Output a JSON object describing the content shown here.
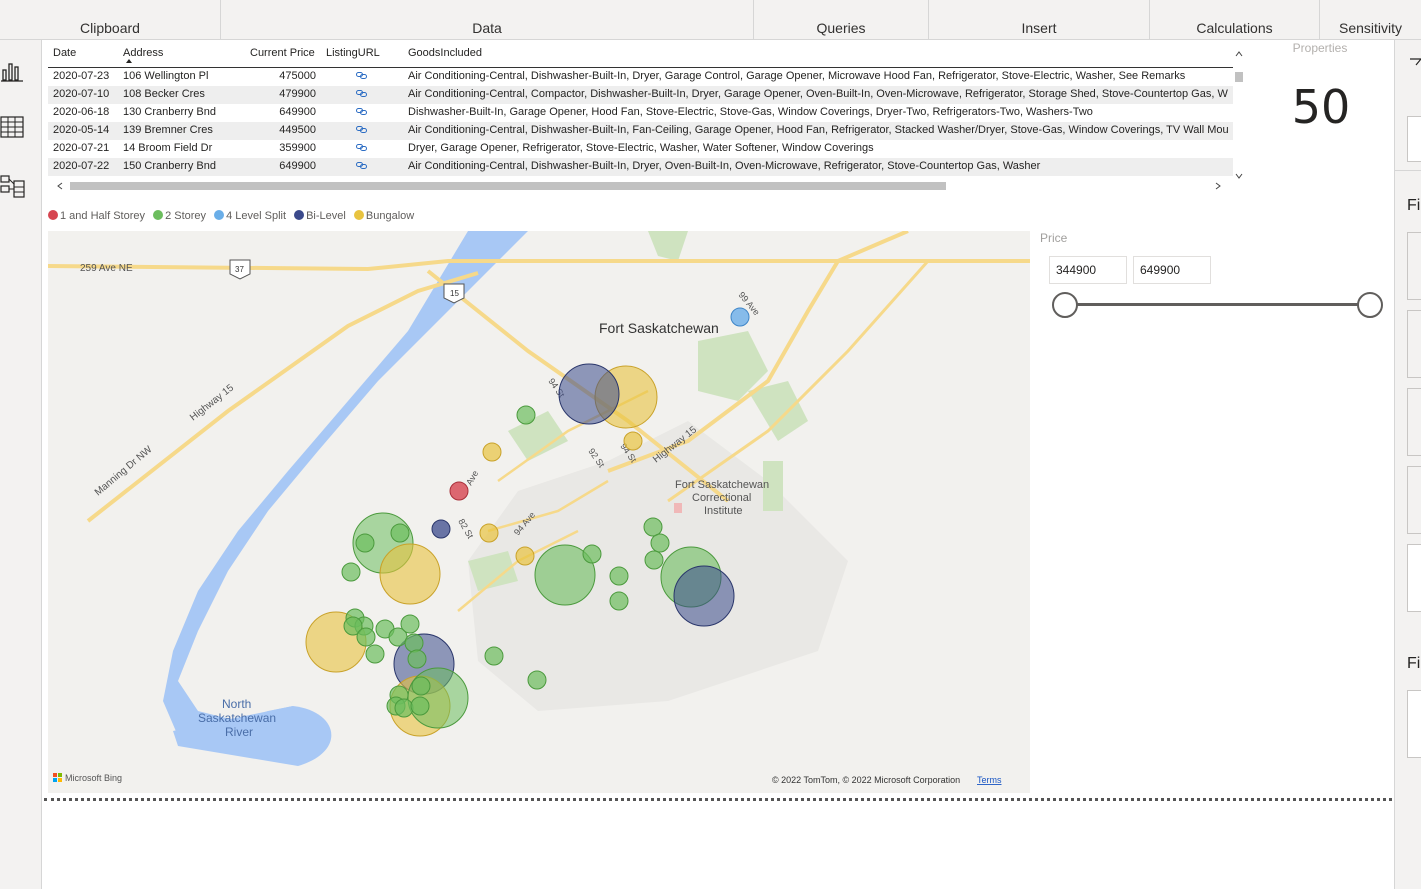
{
  "ribbon": {
    "groups": [
      "Clipboard",
      "Data",
      "Queries",
      "Insert",
      "Calculations",
      "Sensitivity"
    ]
  },
  "table": {
    "headers": [
      "Date",
      "Address",
      "Current Price",
      "ListingURL",
      "GoodsIncluded"
    ],
    "rows": [
      {
        "date": "2020-07-23",
        "address": "106 Wellington Pl",
        "price": "475000",
        "goods": "Air Conditioning-Central, Dishwasher-Built-In, Dryer, Garage Control, Garage Opener, Microwave Hood Fan, Refrigerator, Stove-Electric, Washer, See Remarks"
      },
      {
        "date": "2020-07-10",
        "address": "108 Becker Cres",
        "price": "479900",
        "goods": "Air Conditioning-Central, Compactor, Dishwasher-Built-In, Dryer, Garage Opener, Oven-Built-In, Oven-Microwave, Refrigerator, Storage Shed, Stove-Countertop Gas, W"
      },
      {
        "date": "2020-06-18",
        "address": "130 Cranberry Bnd",
        "price": "649900",
        "goods": "Dishwasher-Built-In, Garage Opener, Hood Fan, Stove-Electric, Stove-Gas, Window Coverings, Dryer-Two, Refrigerators-Two, Washers-Two"
      },
      {
        "date": "2020-05-14",
        "address": "139 Bremner Cres",
        "price": "449500",
        "goods": "Air Conditioning-Central, Dishwasher-Built-In, Fan-Ceiling, Garage Opener, Hood Fan, Refrigerator, Stacked Washer/Dryer, Stove-Gas, Window Coverings, TV Wall Mou"
      },
      {
        "date": "2020-07-21",
        "address": "14 Broom Field Dr",
        "price": "359900",
        "goods": "Dryer, Garage Opener, Refrigerator, Stove-Electric, Washer, Water Softener, Window Coverings"
      },
      {
        "date": "2020-07-22",
        "address": "150 Cranberry Bnd",
        "price": "649900",
        "goods": "Air Conditioning-Central, Dishwasher-Built-In, Dryer, Oven-Built-In, Oven-Microwave, Refrigerator, Stove-Countertop Gas, Washer"
      }
    ]
  },
  "legend": [
    {
      "label": "1 and Half Storey",
      "color": "#d64550"
    },
    {
      "label": "2 Storey",
      "color": "#6cbd5e"
    },
    {
      "label": "4 Level Split",
      "color": "#6aaee8"
    },
    {
      "label": "Bi-Level",
      "color": "#3b4a8c"
    },
    {
      "label": "Bungalow",
      "color": "#e8c340"
    }
  ],
  "map": {
    "labels": {
      "city": "Fort Saskatchewan",
      "road_259": "259 Ave NE",
      "shield_37": "37",
      "shield_15": "15",
      "highway15_a": "Highway 15",
      "highway15_b": "Highway 15",
      "manning": "Manning Dr NW",
      "ave99": "99 Ave",
      "st94": "94 St",
      "st94b": "94 St",
      "st92": "92 St",
      "st82": "82 St",
      "ave94": "94 Ave",
      "ave_small": "Ave",
      "institute1": "Fort Saskatchewan",
      "institute2": "Correctional",
      "institute3": "Institute",
      "river1": "North",
      "river2": "Saskatchewan",
      "river3": "River",
      "bing": "Microsoft Bing",
      "copyright": "© 2022 TomTom, © 2022 Microsoft Corporation",
      "terms": "Terms"
    }
  },
  "card": {
    "label": "Properties",
    "value": "50"
  },
  "slicer": {
    "title": "Price",
    "min": "344900",
    "max": "649900"
  },
  "side": {
    "label1": "Fi",
    "label2": "Fi"
  }
}
